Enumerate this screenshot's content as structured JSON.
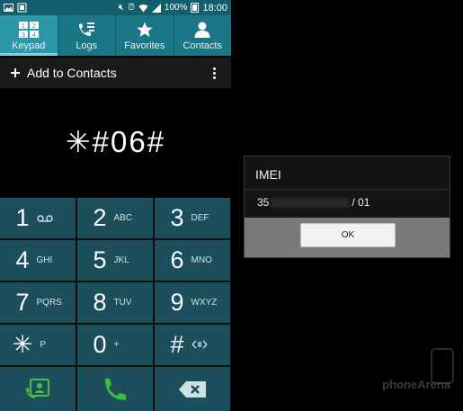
{
  "status_bar": {
    "battery": "100%",
    "time": "18:00"
  },
  "tabs": [
    {
      "label": "Keypad",
      "icon": "keypad-icon",
      "active": true
    },
    {
      "label": "Logs",
      "icon": "logs-icon",
      "active": false
    },
    {
      "label": "Favorites",
      "icon": "star-icon",
      "active": false
    },
    {
      "label": "Contacts",
      "icon": "person-icon",
      "active": false
    }
  ],
  "action_row": {
    "add_label": "Add to Contacts"
  },
  "dialed_number": "✳#06#",
  "keys": [
    {
      "num": "1",
      "sub": ""
    },
    {
      "num": "2",
      "sub": "ABC"
    },
    {
      "num": "3",
      "sub": "DEF"
    },
    {
      "num": "4",
      "sub": "GHI"
    },
    {
      "num": "5",
      "sub": "JKL"
    },
    {
      "num": "6",
      "sub": "MNO"
    },
    {
      "num": "7",
      "sub": "PQRS"
    },
    {
      "num": "8",
      "sub": "TUV"
    },
    {
      "num": "9",
      "sub": "WXYZ"
    },
    {
      "num": "✳",
      "sub": "P"
    },
    {
      "num": "0",
      "sub": "+"
    },
    {
      "num": "#",
      "sub": ""
    }
  ],
  "dialog": {
    "title": "IMEI",
    "value_prefix": "35",
    "value_suffix": "/ 01",
    "ok_label": "OK"
  },
  "watermark": "phoneArena",
  "colors": {
    "status_bar": "#125e6c",
    "tab_bar": "#1a7684",
    "tab_active": "#2b97a8",
    "key_bg": "#1c4e5b",
    "call_green": "#3bbf3b"
  }
}
